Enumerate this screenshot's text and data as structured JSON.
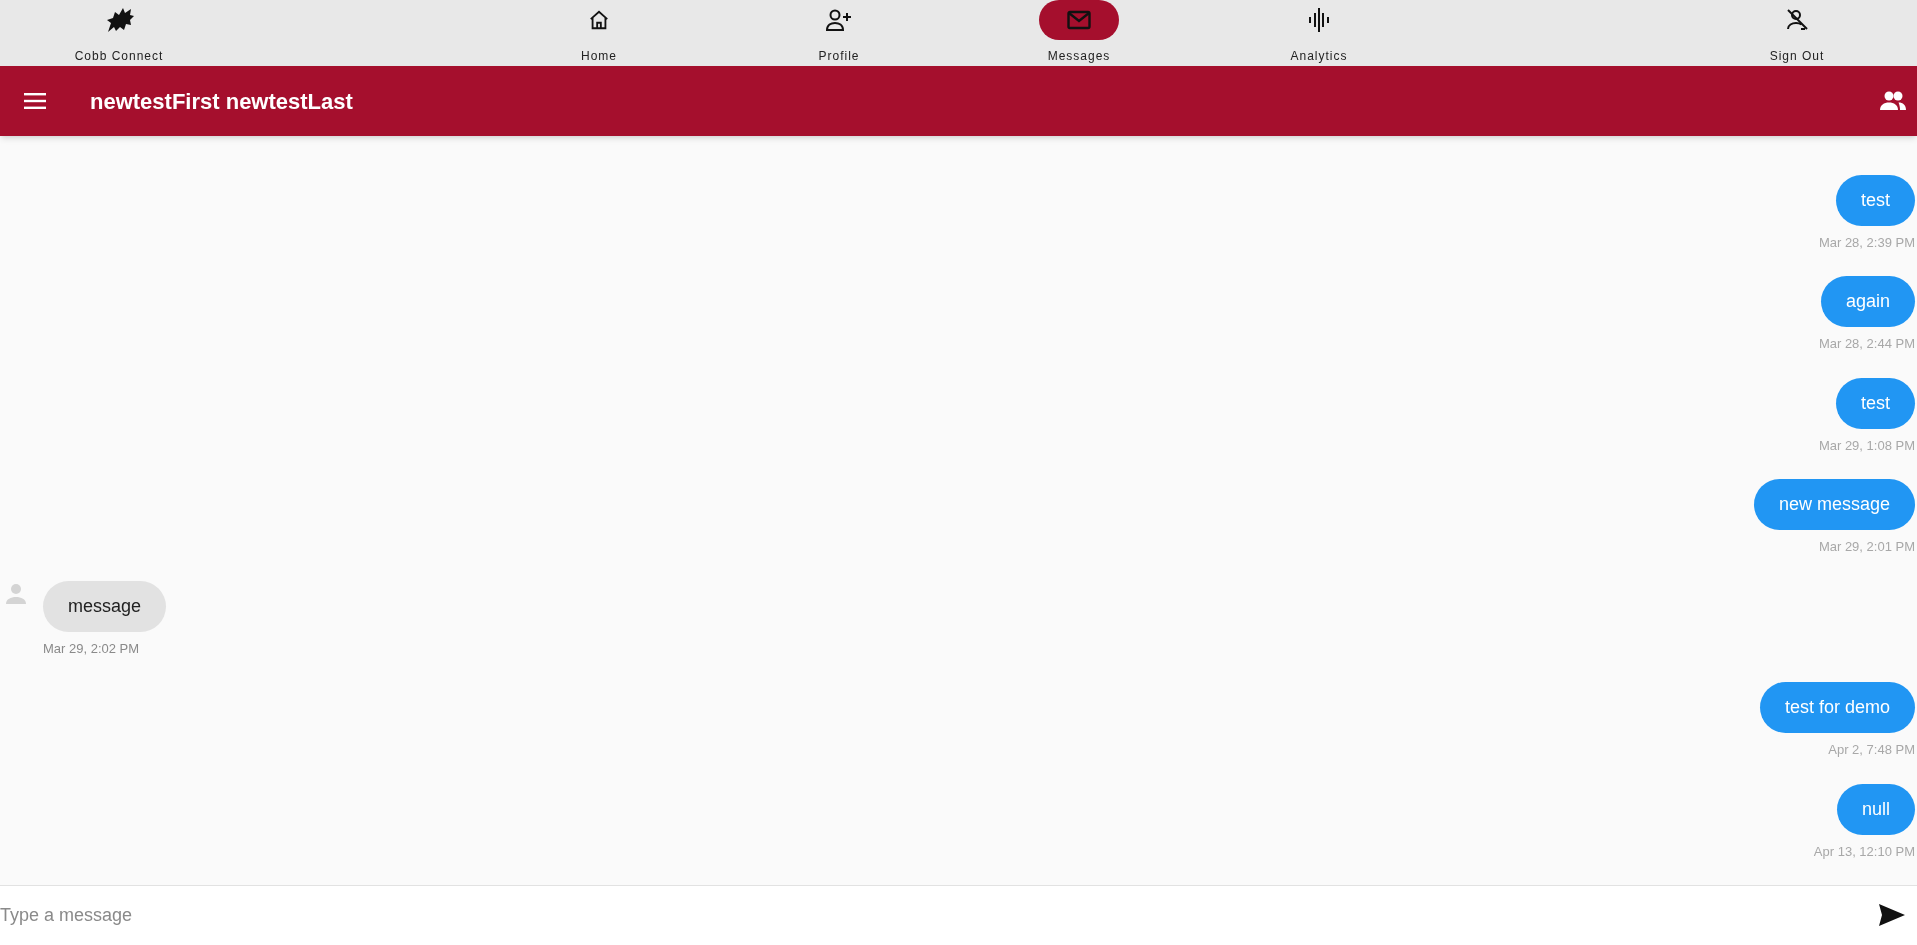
{
  "nav": {
    "brand": {
      "label": "Cobb Connect"
    },
    "items": [
      {
        "kind": "home",
        "label": "Home",
        "selected": false
      },
      {
        "kind": "profile",
        "label": "Profile",
        "selected": false
      },
      {
        "kind": "messages",
        "label": "Messages",
        "selected": true
      },
      {
        "kind": "analytics",
        "label": "Analytics",
        "selected": false
      }
    ],
    "sign_out": {
      "label": "Sign Out"
    }
  },
  "header": {
    "title": "newtestFirst newtestLast"
  },
  "messages": [
    {
      "kind": "sent",
      "text": "test",
      "time": "Mar 28, 2:39 PM"
    },
    {
      "kind": "sent",
      "text": "again",
      "time": "Mar 28, 2:44 PM"
    },
    {
      "kind": "sent",
      "text": "test",
      "time": "Mar 29, 1:08 PM"
    },
    {
      "kind": "sent",
      "text": "new message",
      "time": "Mar 29, 2:01 PM"
    },
    {
      "kind": "received",
      "text": "message",
      "time": "Mar 29, 2:02 PM"
    },
    {
      "kind": "sent",
      "text": "test for demo",
      "time": "Apr 2, 7:48 PM"
    },
    {
      "kind": "sent",
      "text": "null",
      "time": "Apr 13, 12:10 PM"
    }
  ],
  "composer": {
    "placeholder": "Type a message"
  }
}
